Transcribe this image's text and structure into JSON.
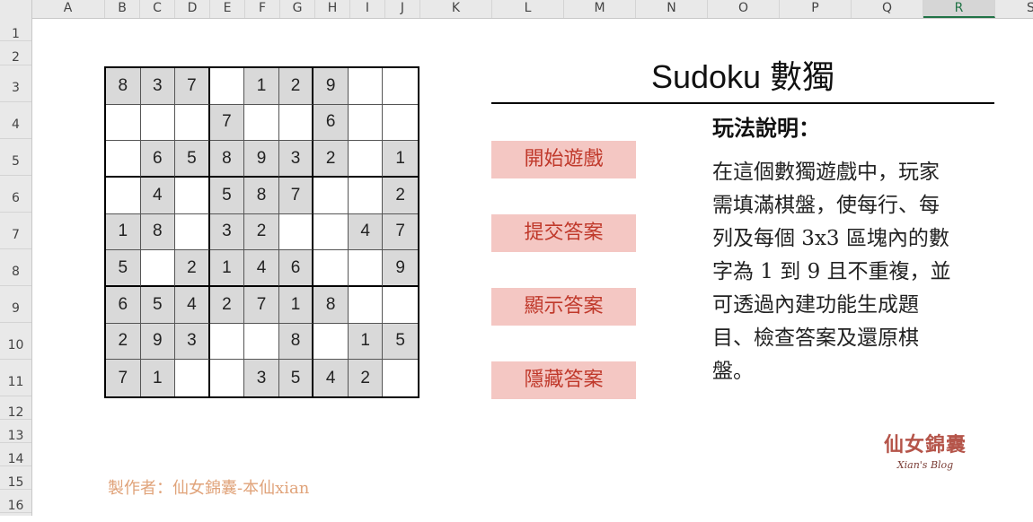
{
  "spreadsheet": {
    "columns": [
      {
        "label": "A",
        "w": 82
      },
      {
        "label": "B",
        "w": 39
      },
      {
        "label": "C",
        "w": 39
      },
      {
        "label": "D",
        "w": 39
      },
      {
        "label": "E",
        "w": 39
      },
      {
        "label": "F",
        "w": 39
      },
      {
        "label": "G",
        "w": 39
      },
      {
        "label": "H",
        "w": 39
      },
      {
        "label": "I",
        "w": 39
      },
      {
        "label": "J",
        "w": 39
      },
      {
        "label": "K",
        "w": 80
      },
      {
        "label": "L",
        "w": 80
      },
      {
        "label": "M",
        "w": 80
      },
      {
        "label": "N",
        "w": 80
      },
      {
        "label": "O",
        "w": 80
      },
      {
        "label": "P",
        "w": 80
      },
      {
        "label": "Q",
        "w": 80
      },
      {
        "label": "R",
        "w": 80
      },
      {
        "label": "S",
        "w": 80
      }
    ],
    "selected_column": "R",
    "rows": [
      {
        "label": "1",
        "h": 26
      },
      {
        "label": "2",
        "h": 27
      },
      {
        "label": "3",
        "h": 41
      },
      {
        "label": "4",
        "h": 41
      },
      {
        "label": "5",
        "h": 41
      },
      {
        "label": "6",
        "h": 41
      },
      {
        "label": "7",
        "h": 41
      },
      {
        "label": "8",
        "h": 41
      },
      {
        "label": "9",
        "h": 41
      },
      {
        "label": "10",
        "h": 41
      },
      {
        "label": "11",
        "h": 41
      },
      {
        "label": "12",
        "h": 26
      },
      {
        "label": "13",
        "h": 26
      },
      {
        "label": "14",
        "h": 26
      },
      {
        "label": "15",
        "h": 26
      },
      {
        "label": "16",
        "h": 26
      }
    ]
  },
  "sudoku": {
    "cells": [
      [
        "8",
        "3",
        "7",
        "",
        "1",
        "2",
        "9",
        "",
        ""
      ],
      [
        "",
        "",
        "",
        "7",
        "",
        "",
        "6",
        "",
        ""
      ],
      [
        "",
        "6",
        "5",
        "8",
        "9",
        "3",
        "2",
        "",
        "1"
      ],
      [
        "",
        "4",
        "",
        "5",
        "8",
        "7",
        "",
        "",
        "2"
      ],
      [
        "1",
        "8",
        "",
        "3",
        "2",
        "",
        "",
        "4",
        "7"
      ],
      [
        "5",
        "",
        "2",
        "1",
        "4",
        "6",
        "",
        "",
        "9"
      ],
      [
        "6",
        "5",
        "4",
        "2",
        "7",
        "1",
        "8",
        "",
        ""
      ],
      [
        "2",
        "9",
        "3",
        "",
        "",
        "8",
        "",
        "1",
        "5"
      ],
      [
        "7",
        "1",
        "",
        "",
        "3",
        "5",
        "4",
        "2",
        ""
      ]
    ]
  },
  "title": "Sudoku 數獨",
  "buttons": {
    "start": "開始遊戲",
    "submit": "提交答案",
    "show": "顯示答案",
    "hide": "隱藏答案"
  },
  "help": {
    "title": "玩法說明：",
    "lines": [
      "在這個數獨遊戲中，玩家",
      "需填滿棋盤，使每行、每",
      "列及每個 3x3 區塊內的數",
      "字為 1 到 9 且不重複，並",
      "可透過內建功能生成題",
      "目、檢查答案及還原棋",
      "盤。"
    ]
  },
  "author": "製作者：仙女錦囊-本仙xian",
  "logo": {
    "line1": "仙女錦囊",
    "line2": "Xian's Blog"
  },
  "colors": {
    "cell_fill": "#d9d9d9",
    "button_fill": "#f4c7c3",
    "button_text": "#c0392b",
    "author_text": "#e0a37a"
  }
}
